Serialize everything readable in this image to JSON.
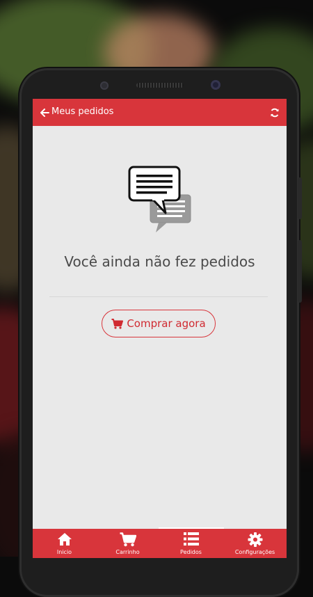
{
  "header": {
    "title": "Meus pedidos",
    "back_icon": "arrow-left-icon",
    "refresh_icon": "refresh-icon"
  },
  "empty_state": {
    "icon": "chat-bubbles-icon",
    "message": "Você ainda não fez pedidos"
  },
  "cta": {
    "label": "Comprar agora",
    "icon": "cart-icon"
  },
  "bottom_nav": {
    "items": [
      {
        "label": "Inicio",
        "icon": "home-icon"
      },
      {
        "label": "Carrinho",
        "icon": "cart-icon"
      },
      {
        "label": "Pedidos",
        "icon": "list-icon",
        "active": true
      },
      {
        "label": "Configurações",
        "icon": "gear-icon"
      }
    ]
  },
  "colors": {
    "brand_red": "#d8353b",
    "screen_bg": "#e9e9e9",
    "text_muted": "#4a4a4a"
  }
}
